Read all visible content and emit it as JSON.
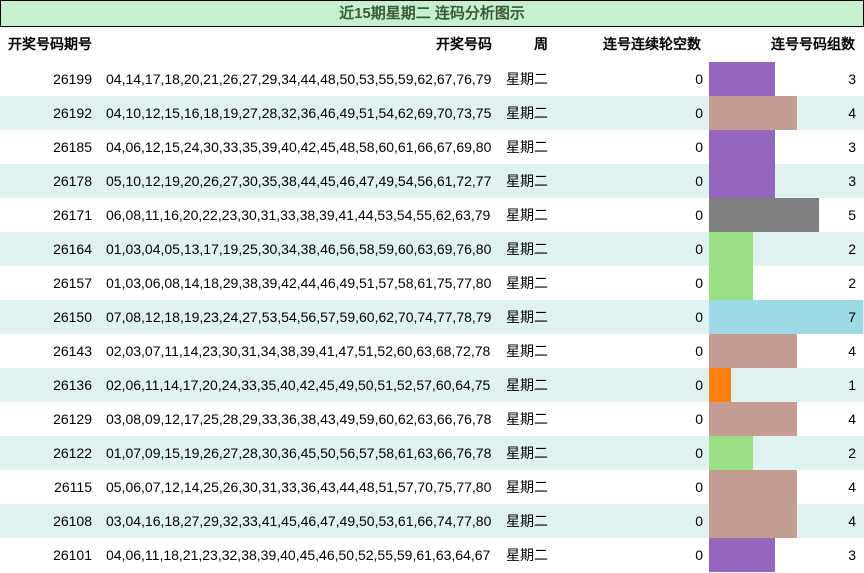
{
  "title": "近15期星期二 连码分析图示",
  "headers": {
    "issue": "开奖号码期号",
    "numbers": "开奖号码",
    "weekday": "周",
    "gap": "连号连续轮空数",
    "groups": "连号号码组数"
  },
  "colors": {
    "title_bg": "#c6efce",
    "row_alt_bg": "#dff1f0",
    "groups_1": "#ff8010",
    "groups_2": "#99e085",
    "groups_3": "#9467bd",
    "groups_4": "#c49c94",
    "groups_5": "#7f7f7f",
    "groups_7": "#9edae5"
  },
  "rows": [
    {
      "issue": "26199",
      "numbers": "04,14,17,18,20,21,26,27,29,34,44,48,50,53,55,59,62,67,76,79",
      "weekday": "星期二",
      "gap": "0",
      "groups": "3"
    },
    {
      "issue": "26192",
      "numbers": "04,10,12,15,16,18,19,27,28,32,36,46,49,51,54,62,69,70,73,75",
      "weekday": "星期二",
      "gap": "0",
      "groups": "4"
    },
    {
      "issue": "26185",
      "numbers": "04,06,12,15,24,30,33,35,39,40,42,45,48,58,60,61,66,67,69,80",
      "weekday": "星期二",
      "gap": "0",
      "groups": "3"
    },
    {
      "issue": "26178",
      "numbers": "05,10,12,19,20,26,27,30,35,38,44,45,46,47,49,54,56,61,72,77",
      "weekday": "星期二",
      "gap": "0",
      "groups": "3"
    },
    {
      "issue": "26171",
      "numbers": "06,08,11,16,20,22,23,30,31,33,38,39,41,44,53,54,55,62,63,79",
      "weekday": "星期二",
      "gap": "0",
      "groups": "5"
    },
    {
      "issue": "26164",
      "numbers": "01,03,04,05,13,17,19,25,30,34,38,46,56,58,59,60,63,69,76,80",
      "weekday": "星期二",
      "gap": "0",
      "groups": "2"
    },
    {
      "issue": "26157",
      "numbers": "01,03,06,08,14,18,29,38,39,42,44,46,49,51,57,58,61,75,77,80",
      "weekday": "星期二",
      "gap": "0",
      "groups": "2"
    },
    {
      "issue": "26150",
      "numbers": "07,08,12,18,19,23,24,27,53,54,56,57,59,60,62,70,74,77,78,79",
      "weekday": "星期二",
      "gap": "0",
      "groups": "7"
    },
    {
      "issue": "26143",
      "numbers": "02,03,07,11,14,23,30,31,34,38,39,41,47,51,52,60,63,68,72,78",
      "weekday": "星期二",
      "gap": "0",
      "groups": "4"
    },
    {
      "issue": "26136",
      "numbers": "02,06,11,14,17,20,24,33,35,40,42,45,49,50,51,52,57,60,64,75",
      "weekday": "星期二",
      "gap": "0",
      "groups": "1"
    },
    {
      "issue": "26129",
      "numbers": "03,08,09,12,17,25,28,29,33,36,38,43,49,59,60,62,63,66,76,78",
      "weekday": "星期二",
      "gap": "0",
      "groups": "4"
    },
    {
      "issue": "26122",
      "numbers": "01,07,09,15,19,26,27,28,30,36,45,50,56,57,58,61,63,66,76,78",
      "weekday": "星期二",
      "gap": "0",
      "groups": "2"
    },
    {
      "issue": "26115",
      "numbers": "05,06,07,12,14,25,26,30,31,33,36,43,44,48,51,57,70,75,77,80",
      "weekday": "星期二",
      "gap": "0",
      "groups": "4"
    },
    {
      "issue": "26108",
      "numbers": "03,04,16,18,27,29,32,33,41,45,46,47,49,50,53,61,66,74,77,80",
      "weekday": "星期二",
      "gap": "0",
      "groups": "4"
    },
    {
      "issue": "26101",
      "numbers": "04,06,11,18,21,23,32,38,39,40,45,46,50,52,55,59,61,63,64,67",
      "weekday": "星期二",
      "gap": "0",
      "groups": "3"
    }
  ]
}
